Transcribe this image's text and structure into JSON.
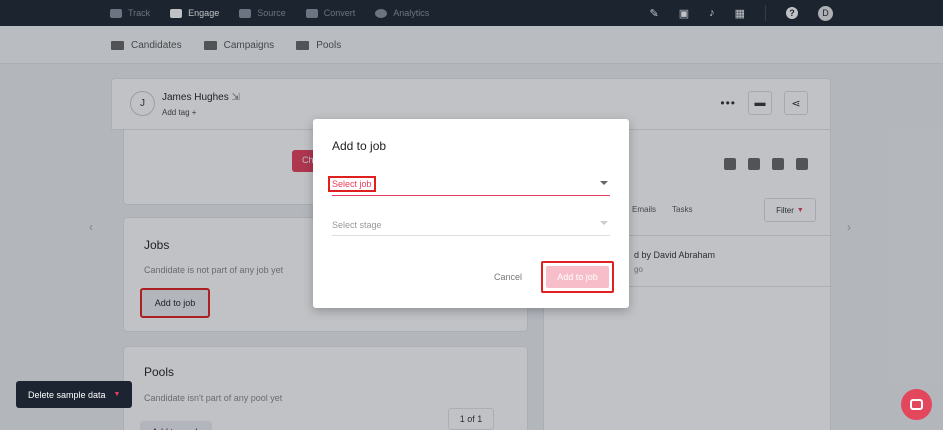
{
  "topbar": {
    "nav": [
      {
        "label": "Track",
        "icon": "track-icon",
        "active": false
      },
      {
        "label": "Engage",
        "icon": "engage-icon",
        "active": true
      },
      {
        "label": "Source",
        "icon": "source-icon",
        "active": false
      },
      {
        "label": "Convert",
        "icon": "convert-icon",
        "active": false
      },
      {
        "label": "Analytics",
        "icon": "analytics-icon",
        "active": false
      }
    ],
    "help_glyph": "?",
    "avatar_initial": "D"
  },
  "subnav": {
    "items": [
      {
        "label": "Candidates",
        "icon": "candidates-icon"
      },
      {
        "label": "Campaigns",
        "icon": "campaigns-icon"
      },
      {
        "label": "Pools",
        "icon": "pools-icon"
      }
    ]
  },
  "profile": {
    "initial": "J",
    "name": "James Hughes",
    "add_tag": "Add tag +",
    "more_glyph": "•••"
  },
  "left": {
    "top_button_partial": "Ch",
    "jobs": {
      "title": "Jobs",
      "subtitle": "Candidate is not part of any job yet",
      "button": "Add to job"
    },
    "pools": {
      "title": "Pools",
      "subtitle": "Candidate isn't part of any pool yet",
      "button": "Add to pool"
    },
    "pager": "1 of 1"
  },
  "right": {
    "tabs": [
      "Emails",
      "Tasks"
    ],
    "filter": "Filter",
    "activity": "d by David Abraham",
    "ago": "go"
  },
  "modal": {
    "title": "Add to job",
    "select_job_placeholder": "Select job",
    "select_stage_placeholder": "Select stage",
    "cancel": "Cancel",
    "confirm": "Add to job"
  },
  "footer": {
    "delete_sample": "Delete sample data"
  },
  "colors": {
    "accent": "#e63e5c",
    "topbar": "#1b2430",
    "highlight": "#e0201e"
  }
}
